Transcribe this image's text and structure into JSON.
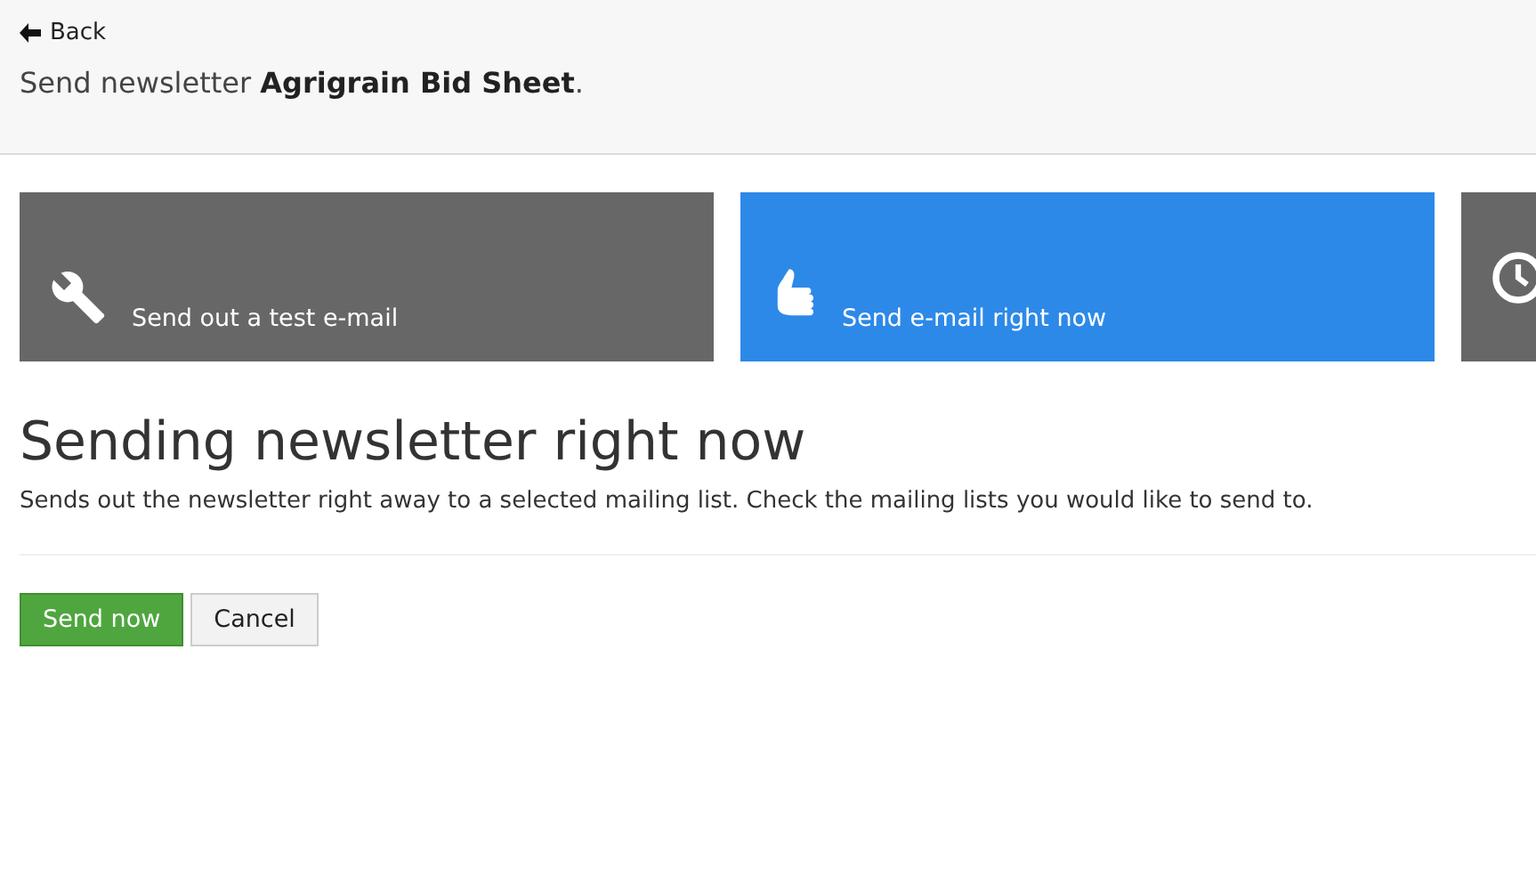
{
  "header": {
    "back_link": "Back",
    "title": "Send newsletter **Agrigrain Bid Sheet**."
  },
  "options": [
    {
      "kind": "test",
      "label": "Send out a test e-mail",
      "selected": false
    },
    {
      "kind": "now",
      "label": "Send e-mail right now",
      "selected": true
    },
    {
      "kind": "schedule",
      "selected": false
    }
  ],
  "section": {
    "heading": "Sending newsletter right now",
    "description": "Sends out the newsletter right away to a selected mailing list. Check the mailing lists you would like to send to."
  },
  "buttons": [
    {
      "kind": "primary",
      "label": "Send now"
    },
    {
      "kind": "secondary",
      "label": "Cancel"
    }
  ]
}
